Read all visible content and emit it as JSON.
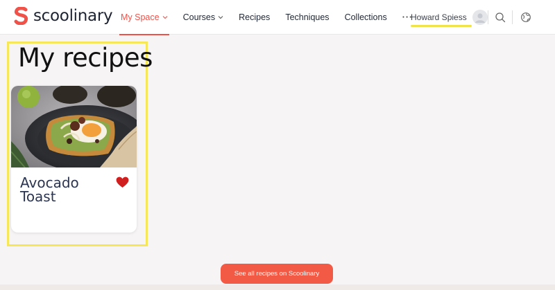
{
  "brand": {
    "name": "scoolinary",
    "accent": "#f0524a"
  },
  "nav": {
    "items": [
      {
        "label": "My Space",
        "active": true,
        "dropdown": true
      },
      {
        "label": "Courses",
        "active": false,
        "dropdown": true
      },
      {
        "label": "Recipes",
        "active": false,
        "dropdown": false
      },
      {
        "label": "Techniques",
        "active": false,
        "dropdown": false
      },
      {
        "label": "Collections",
        "active": false,
        "dropdown": false
      }
    ],
    "more_label": "···"
  },
  "user": {
    "name": "Howard Spiess",
    "avatar_icon": "user-avatar-icon"
  },
  "header_icons": [
    "search-icon",
    "globe-icon"
  ],
  "main": {
    "title": "My recipes",
    "recipes": [
      {
        "title": "Avocado Toast",
        "favorited": true
      }
    ],
    "cta_label": "See all recipes on Scoolinary"
  }
}
